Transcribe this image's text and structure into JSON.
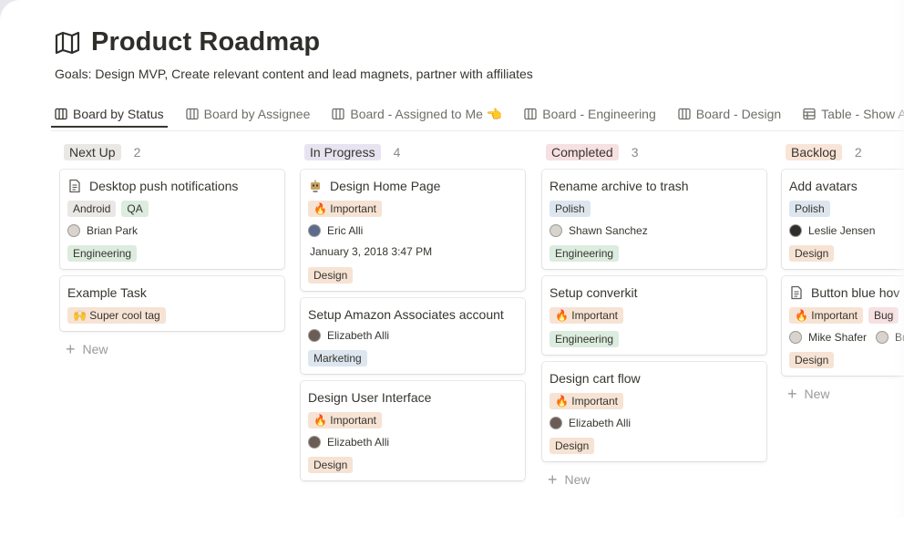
{
  "page": {
    "title": "Product Roadmap",
    "goals": "Goals: Design MVP, Create relevant content and lead magnets, partner with affiliates"
  },
  "tabs": [
    {
      "label": "Board by Status",
      "icon": "board-icon",
      "active": true
    },
    {
      "label": "Board by Assignee",
      "icon": "board-icon"
    },
    {
      "label": "Board - Assigned to Me 👈",
      "icon": "board-icon"
    },
    {
      "label": "Board - Engineering",
      "icon": "board-icon"
    },
    {
      "label": "Board - Design",
      "icon": "board-icon"
    },
    {
      "label": "Table - Show All",
      "icon": "table-icon"
    }
  ],
  "new_label": "New",
  "columns": [
    {
      "name": "Next Up",
      "count": "2",
      "color": "#e9e8e5",
      "cards": [
        {
          "title": "Desktop push notifications",
          "icon": "page-icon",
          "tags": [
            {
              "label": "Android",
              "color": "#e9e8e5"
            },
            {
              "label": "QA",
              "color": "#dcecdf"
            }
          ],
          "people": [
            {
              "name": "Brian Park",
              "avatar": "#d8d3cc"
            }
          ],
          "tags2": [
            {
              "label": "Engineering",
              "color": "#dcecdf"
            }
          ]
        },
        {
          "title": "Example Task",
          "tags": [
            {
              "label": "🙌 Super cool tag",
              "color": "#f6e3d4"
            }
          ]
        }
      ]
    },
    {
      "name": "In Progress",
      "count": "4",
      "color": "#e7e3f0",
      "cards": [
        {
          "title": "Design Home Page",
          "icon": "robot-icon",
          "tags": [
            {
              "label": "🔥 Important",
              "color": "#f6e3d4"
            }
          ],
          "people": [
            {
              "name": "Eric Alli",
              "avatar": "#5b6b8a"
            }
          ],
          "date": "January 3, 2018 3:47 PM",
          "tags2": [
            {
              "label": "Design",
              "color": "#f6e3d4"
            }
          ]
        },
        {
          "title": "Setup Amazon Associates account",
          "people": [
            {
              "name": "Elizabeth Alli",
              "avatar": "#6b5d55"
            }
          ],
          "tags2": [
            {
              "label": "Marketing",
              "color": "#dde6ef"
            }
          ]
        },
        {
          "title": "Design User Interface",
          "tags": [
            {
              "label": "🔥 Important",
              "color": "#f6e3d4"
            }
          ],
          "people": [
            {
              "name": "Elizabeth Alli",
              "avatar": "#6b5d55"
            }
          ],
          "tags2": [
            {
              "label": "Design",
              "color": "#f6e3d4"
            }
          ]
        }
      ]
    },
    {
      "name": "Completed",
      "count": "3",
      "color": "#f6e0e2",
      "cards": [
        {
          "title": "Rename archive to trash",
          "tags": [
            {
              "label": "Polish",
              "color": "#dde6ef"
            }
          ],
          "people": [
            {
              "name": "Shawn Sanchez",
              "avatar": "#d8d3cc"
            }
          ],
          "tags2": [
            {
              "label": "Engineering",
              "color": "#dcecdf"
            }
          ]
        },
        {
          "title": "Setup converkit",
          "tags": [
            {
              "label": "🔥 Important",
              "color": "#f6e3d4"
            }
          ],
          "tags2": [
            {
              "label": "Engineering",
              "color": "#dcecdf"
            }
          ]
        },
        {
          "title": "Design cart flow",
          "tags": [
            {
              "label": "🔥 Important",
              "color": "#f6e3d4"
            }
          ],
          "people": [
            {
              "name": "Elizabeth Alli",
              "avatar": "#6b5d55"
            }
          ],
          "tags2": [
            {
              "label": "Design",
              "color": "#f6e3d4"
            }
          ]
        }
      ]
    },
    {
      "name": "Backlog",
      "count": "2",
      "color": "#f9e4d8",
      "cards": [
        {
          "title": "Add avatars",
          "tags": [
            {
              "label": "Polish",
              "color": "#dde6ef"
            }
          ],
          "people": [
            {
              "name": "Leslie Jensen",
              "avatar": "#2f2e2b"
            }
          ],
          "tags2": [
            {
              "label": "Design",
              "color": "#f6e3d4"
            }
          ]
        },
        {
          "title": "Button blue hov",
          "icon": "page-icon",
          "tags": [
            {
              "label": "🔥 Important",
              "color": "#f6e3d4"
            },
            {
              "label": "Bug",
              "color": "#f6e0e2"
            }
          ],
          "people": [
            {
              "name": "Mike Shafer",
              "avatar": "#d8d3cc"
            },
            {
              "name": "Br",
              "avatar": "#d8d3cc"
            }
          ],
          "tags2": [
            {
              "label": "Design",
              "color": "#f6e3d4"
            }
          ]
        }
      ]
    }
  ]
}
